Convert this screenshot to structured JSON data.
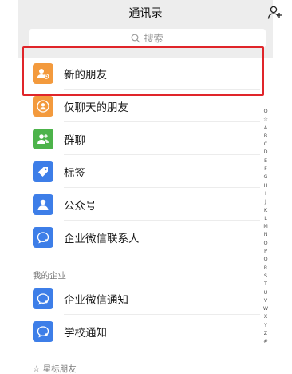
{
  "header": {
    "title": "通讯录"
  },
  "search": {
    "placeholder": "搜索"
  },
  "rows": [
    {
      "label": "新的朋友",
      "icon": "new-friend-icon",
      "color": "#f39a3d"
    },
    {
      "label": "仅聊天的朋友",
      "icon": "chat-only-friend-icon",
      "color": "#f39a3d"
    },
    {
      "label": "群聊",
      "icon": "group-chat-icon",
      "color": "#4cb34a"
    },
    {
      "label": "标签",
      "icon": "tag-icon",
      "color": "#3d7ee8"
    },
    {
      "label": "公众号",
      "icon": "official-account-icon",
      "color": "#3d7ee8"
    },
    {
      "label": "企业微信联系人",
      "icon": "wework-contact-icon",
      "color": "#3d7ee8"
    }
  ],
  "sections": {
    "enterprise": {
      "title": "我的企业",
      "items": [
        {
          "label": "企业微信通知",
          "icon": "wework-notice-icon",
          "color": "#3d7ee8"
        },
        {
          "label": "学校通知",
          "icon": "school-notice-icon",
          "color": "#3d7ee8"
        }
      ]
    },
    "starred": {
      "title": "☆ 星标朋友"
    }
  },
  "index_letters": [
    "Q",
    "☆",
    "A",
    "B",
    "C",
    "D",
    "E",
    "F",
    "G",
    "H",
    "I",
    "J",
    "K",
    "L",
    "M",
    "N",
    "O",
    "P",
    "Q",
    "R",
    "S",
    "T",
    "U",
    "V",
    "W",
    "X",
    "Y",
    "Z",
    "#"
  ],
  "colors": {
    "highlight": "#e0252a",
    "orange": "#f39a3d",
    "green": "#4cb34a",
    "blue": "#3d7ee8"
  }
}
